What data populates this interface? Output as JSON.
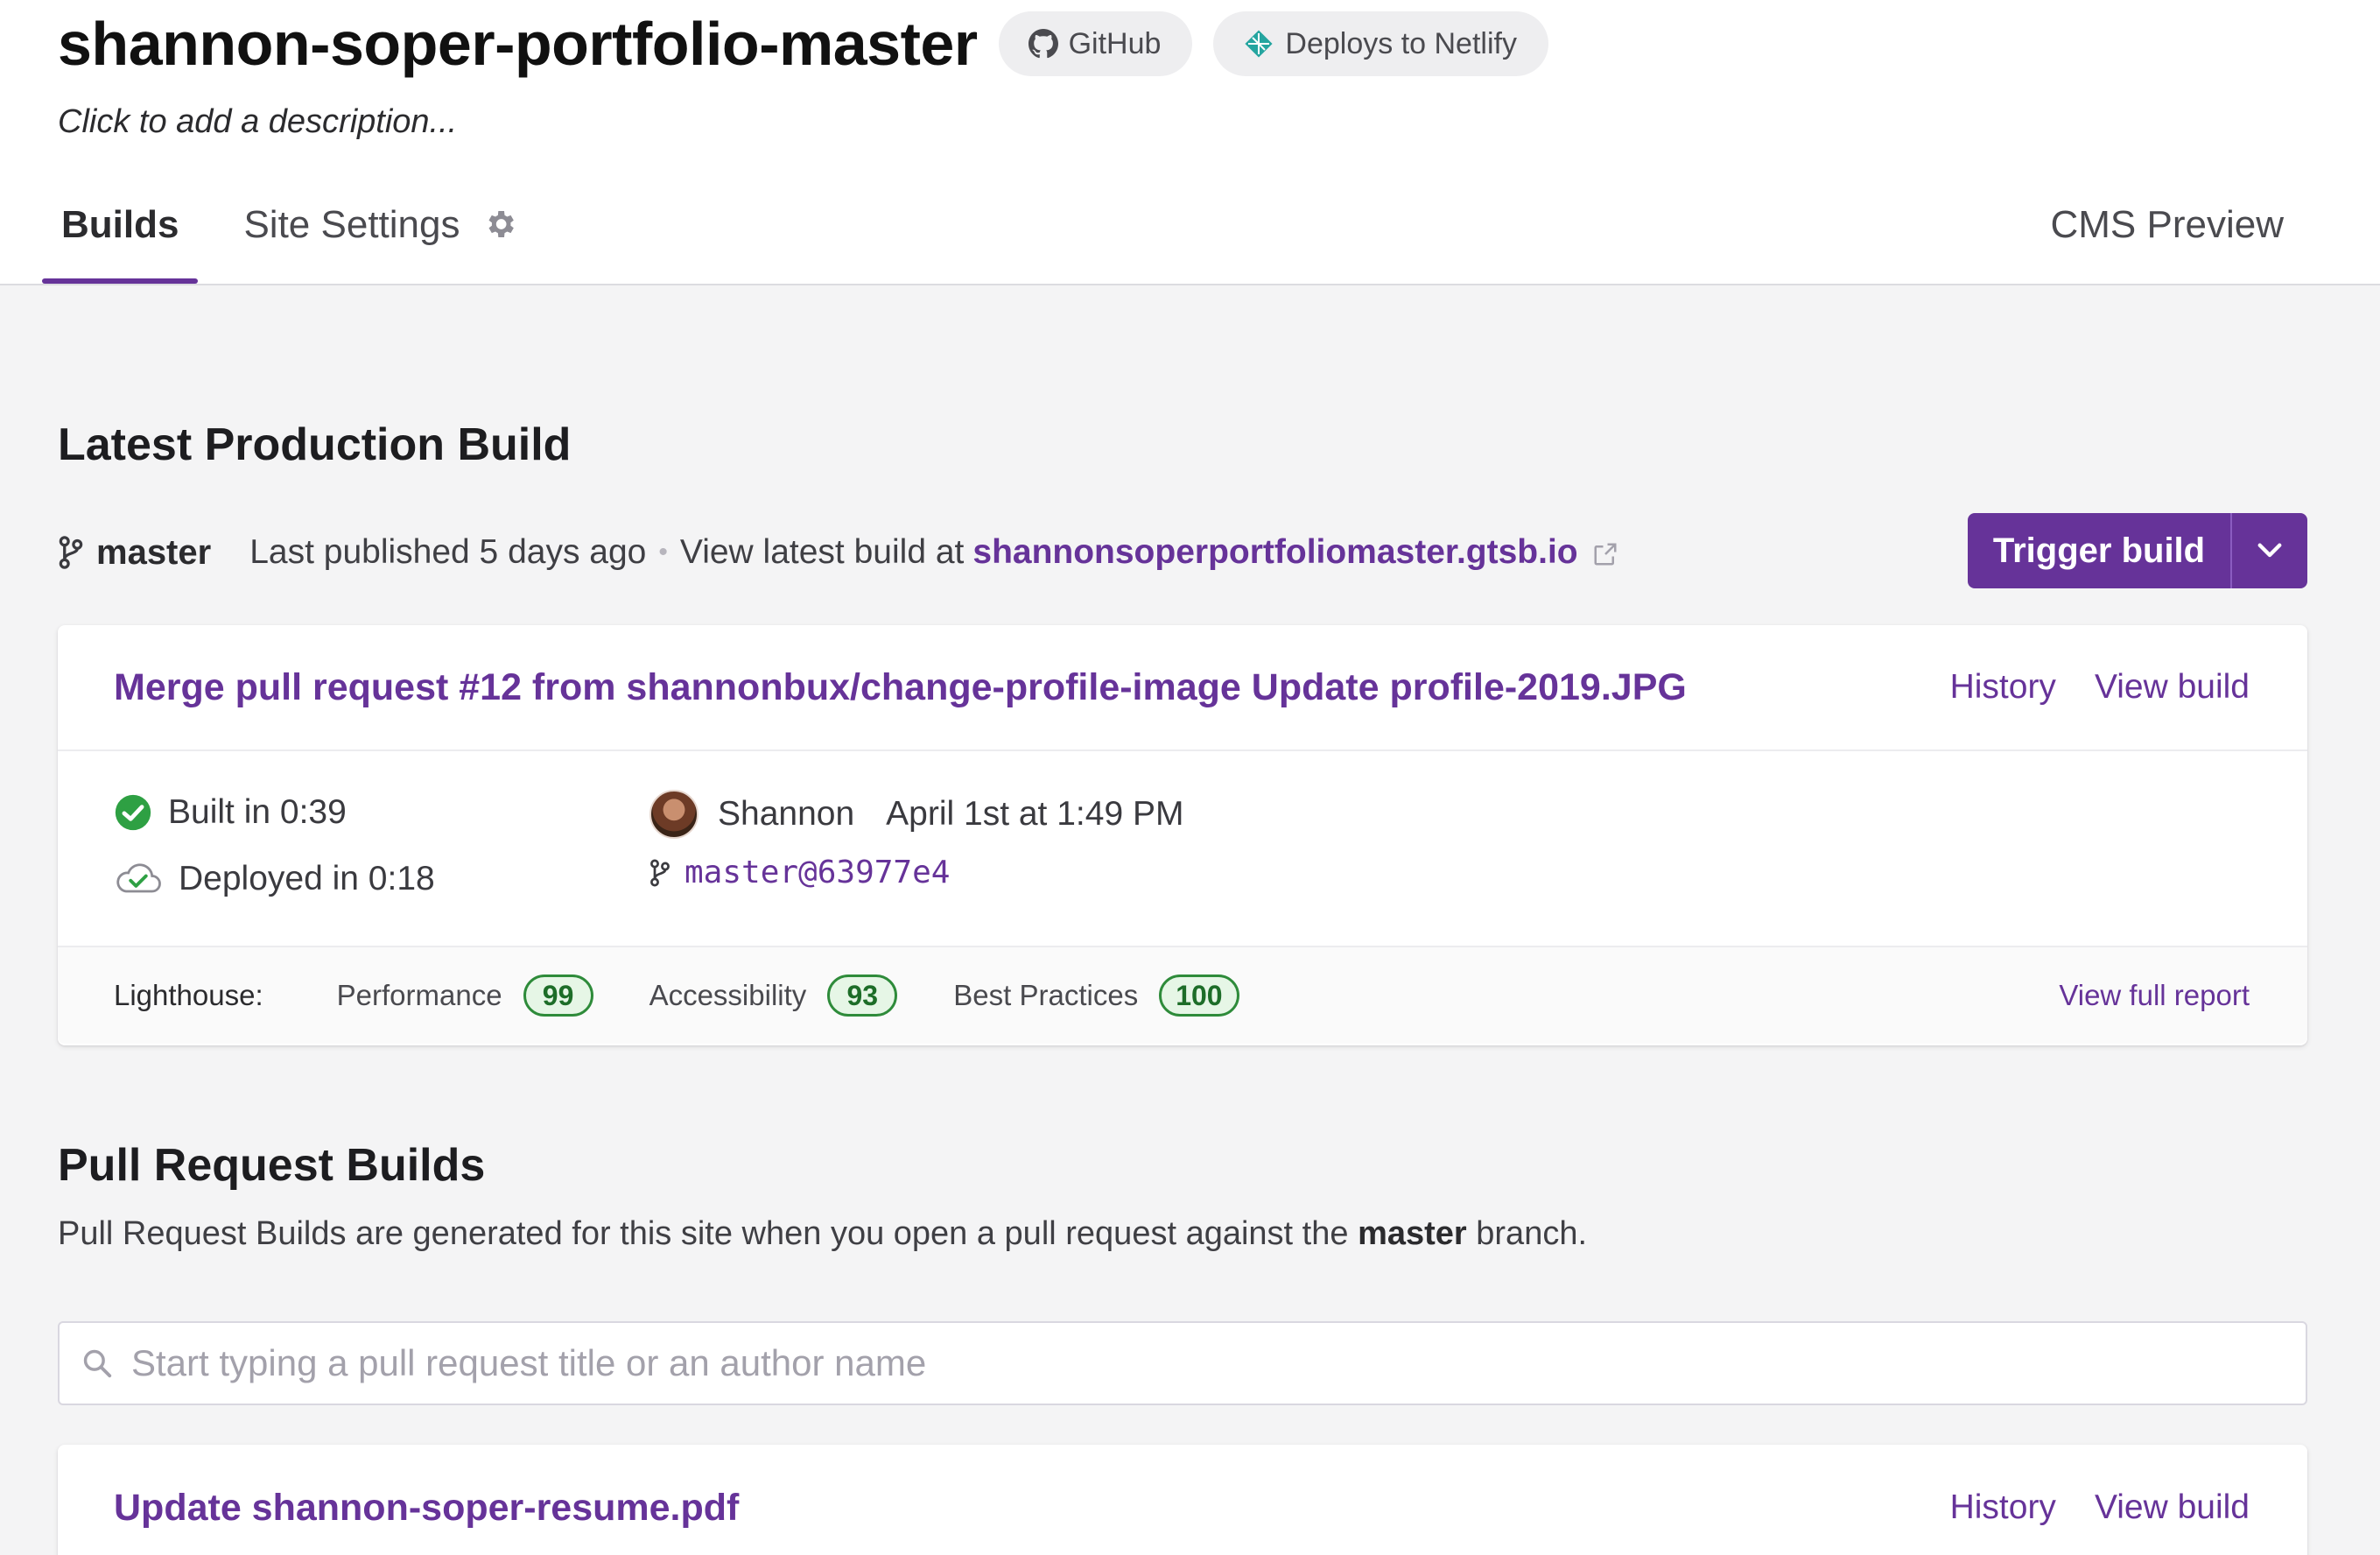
{
  "site": {
    "title": "shannon-soper-portfolio-master",
    "github_label": "GitHub",
    "netlify_label": "Deploys to Netlify",
    "description_placeholder": "Click to add a description..."
  },
  "tabs": [
    {
      "label": "Builds",
      "active": true
    },
    {
      "label": "Site Settings",
      "active": false
    },
    {
      "label": "CMS Preview",
      "active": false
    }
  ],
  "production": {
    "section_title": "Latest Production Build",
    "branch": "master",
    "published": "Last published 5 days ago",
    "view_latest_prefix": "View latest build at",
    "site_url": "shannonsoperportfoliomaster.gtsb.io",
    "trigger_label": "Trigger build",
    "build": {
      "commit_title": "Merge pull request #12 from shannonbux/change-profile-image Update profile-2019.JPG",
      "history_label": "History",
      "view_build_label": "View build",
      "built": "Built in 0:39",
      "deployed": "Deployed in 0:18",
      "author": "Shannon",
      "date": "April 1st at 1:49 PM",
      "commit_ref": "master@63977e4"
    },
    "lighthouse": {
      "label": "Lighthouse:",
      "performance_label": "Performance",
      "performance": "99",
      "accessibility_label": "Accessibility",
      "accessibility": "93",
      "best_practices_label": "Best Practices",
      "best_practices": "100",
      "report_label": "View full report"
    }
  },
  "pull_requests": {
    "section_title": "Pull Request Builds",
    "desc_prefix": "Pull Request Builds are generated for this site when you open a pull request against the",
    "desc_branch": "master",
    "desc_suffix": "branch.",
    "search_placeholder": "Start typing a pull request title or an author name",
    "items": [
      {
        "title": "Update shannon-soper-resume.pdf",
        "history_label": "History",
        "view_build_label": "View build"
      }
    ]
  },
  "colors": {
    "accent": "#663399",
    "success": "#2e8b3a",
    "background": "#f4f4f5"
  },
  "icons": [
    "github-icon",
    "netlify-icon",
    "gear-icon",
    "branch-icon",
    "external-link-icon",
    "chevron-down-icon",
    "check-circle-icon",
    "cloud-check-icon",
    "search-icon"
  ]
}
